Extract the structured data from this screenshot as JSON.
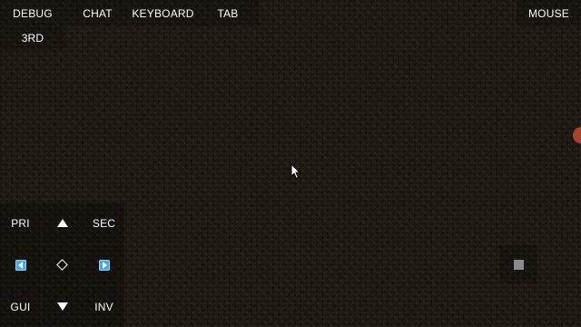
{
  "top_bar": {
    "debug": "DEBUG",
    "chat": "CHAT",
    "keyboard": "KEYBOARD",
    "tab": "TAB",
    "third_person": "3RD",
    "mouse": "MOUSE"
  },
  "controls": {
    "primary": "PRI",
    "secondary": "SEC",
    "gui": "GUI",
    "inventory": "INV"
  },
  "icons": {
    "up": "arrow-up-icon",
    "down": "arrow-down-icon",
    "left": "arrow-left-icon",
    "right": "arrow-right-icon",
    "center": "diamond-icon",
    "square": "square-icon"
  },
  "colors": {
    "dirt_background": "#1e1913",
    "arrow_accent": "#4aa8e0",
    "edge_dot": "#a5442c"
  }
}
